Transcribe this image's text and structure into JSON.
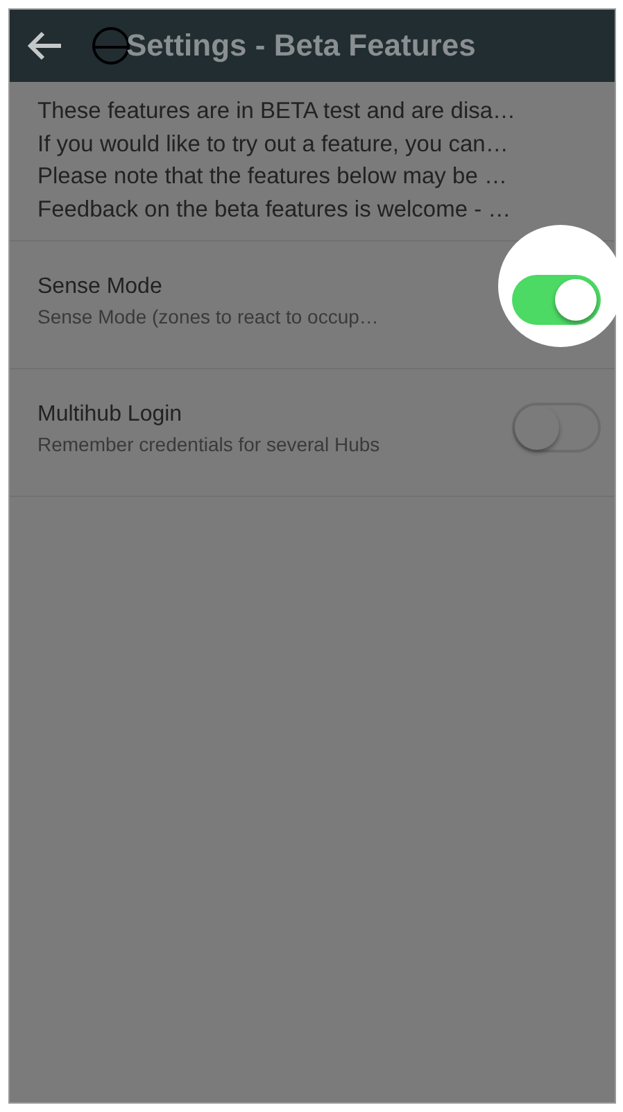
{
  "header": {
    "title": "Settings - Beta Features"
  },
  "intro_lines": [
    "These features are in BETA test and are disa…",
    "If you would like to try out a feature, you can…",
    "Please note that the features below may be …",
    "Feedback on the beta features is welcome - …"
  ],
  "settings": [
    {
      "title": "Sense Mode",
      "subtitle": "Sense Mode (zones to react to occup…",
      "on": true,
      "highlighted": true
    },
    {
      "title": "Multihub Login",
      "subtitle": "Remember credentials for several Hubs",
      "on": false,
      "highlighted": false
    }
  ]
}
